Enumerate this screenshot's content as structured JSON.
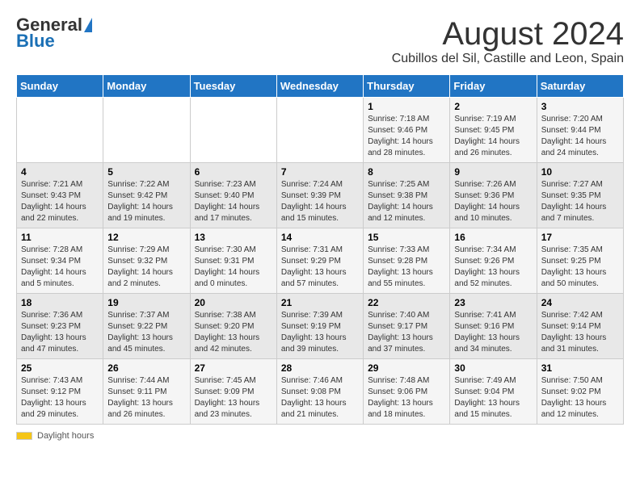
{
  "header": {
    "logo_line1": "General",
    "logo_line2": "Blue",
    "main_title": "August 2024",
    "subtitle": "Cubillos del Sil, Castille and Leon, Spain"
  },
  "calendar": {
    "days_of_week": [
      "Sunday",
      "Monday",
      "Tuesday",
      "Wednesday",
      "Thursday",
      "Friday",
      "Saturday"
    ],
    "weeks": [
      [
        {
          "day": "",
          "sunrise": "",
          "sunset": "",
          "daylight": ""
        },
        {
          "day": "",
          "sunrise": "",
          "sunset": "",
          "daylight": ""
        },
        {
          "day": "",
          "sunrise": "",
          "sunset": "",
          "daylight": ""
        },
        {
          "day": "",
          "sunrise": "",
          "sunset": "",
          "daylight": ""
        },
        {
          "day": "1",
          "sunrise": "7:18 AM",
          "sunset": "9:46 PM",
          "daylight": "14 hours and 28 minutes."
        },
        {
          "day": "2",
          "sunrise": "7:19 AM",
          "sunset": "9:45 PM",
          "daylight": "14 hours and 26 minutes."
        },
        {
          "day": "3",
          "sunrise": "7:20 AM",
          "sunset": "9:44 PM",
          "daylight": "14 hours and 24 minutes."
        }
      ],
      [
        {
          "day": "4",
          "sunrise": "7:21 AM",
          "sunset": "9:43 PM",
          "daylight": "14 hours and 22 minutes."
        },
        {
          "day": "5",
          "sunrise": "7:22 AM",
          "sunset": "9:42 PM",
          "daylight": "14 hours and 19 minutes."
        },
        {
          "day": "6",
          "sunrise": "7:23 AM",
          "sunset": "9:40 PM",
          "daylight": "14 hours and 17 minutes."
        },
        {
          "day": "7",
          "sunrise": "7:24 AM",
          "sunset": "9:39 PM",
          "daylight": "14 hours and 15 minutes."
        },
        {
          "day": "8",
          "sunrise": "7:25 AM",
          "sunset": "9:38 PM",
          "daylight": "14 hours and 12 minutes."
        },
        {
          "day": "9",
          "sunrise": "7:26 AM",
          "sunset": "9:36 PM",
          "daylight": "14 hours and 10 minutes."
        },
        {
          "day": "10",
          "sunrise": "7:27 AM",
          "sunset": "9:35 PM",
          "daylight": "14 hours and 7 minutes."
        }
      ],
      [
        {
          "day": "11",
          "sunrise": "7:28 AM",
          "sunset": "9:34 PM",
          "daylight": "14 hours and 5 minutes."
        },
        {
          "day": "12",
          "sunrise": "7:29 AM",
          "sunset": "9:32 PM",
          "daylight": "14 hours and 2 minutes."
        },
        {
          "day": "13",
          "sunrise": "7:30 AM",
          "sunset": "9:31 PM",
          "daylight": "14 hours and 0 minutes."
        },
        {
          "day": "14",
          "sunrise": "7:31 AM",
          "sunset": "9:29 PM",
          "daylight": "13 hours and 57 minutes."
        },
        {
          "day": "15",
          "sunrise": "7:33 AM",
          "sunset": "9:28 PM",
          "daylight": "13 hours and 55 minutes."
        },
        {
          "day": "16",
          "sunrise": "7:34 AM",
          "sunset": "9:26 PM",
          "daylight": "13 hours and 52 minutes."
        },
        {
          "day": "17",
          "sunrise": "7:35 AM",
          "sunset": "9:25 PM",
          "daylight": "13 hours and 50 minutes."
        }
      ],
      [
        {
          "day": "18",
          "sunrise": "7:36 AM",
          "sunset": "9:23 PM",
          "daylight": "13 hours and 47 minutes."
        },
        {
          "day": "19",
          "sunrise": "7:37 AM",
          "sunset": "9:22 PM",
          "daylight": "13 hours and 45 minutes."
        },
        {
          "day": "20",
          "sunrise": "7:38 AM",
          "sunset": "9:20 PM",
          "daylight": "13 hours and 42 minutes."
        },
        {
          "day": "21",
          "sunrise": "7:39 AM",
          "sunset": "9:19 PM",
          "daylight": "13 hours and 39 minutes."
        },
        {
          "day": "22",
          "sunrise": "7:40 AM",
          "sunset": "9:17 PM",
          "daylight": "13 hours and 37 minutes."
        },
        {
          "day": "23",
          "sunrise": "7:41 AM",
          "sunset": "9:16 PM",
          "daylight": "13 hours and 34 minutes."
        },
        {
          "day": "24",
          "sunrise": "7:42 AM",
          "sunset": "9:14 PM",
          "daylight": "13 hours and 31 minutes."
        }
      ],
      [
        {
          "day": "25",
          "sunrise": "7:43 AM",
          "sunset": "9:12 PM",
          "daylight": "13 hours and 29 minutes."
        },
        {
          "day": "26",
          "sunrise": "7:44 AM",
          "sunset": "9:11 PM",
          "daylight": "13 hours and 26 minutes."
        },
        {
          "day": "27",
          "sunrise": "7:45 AM",
          "sunset": "9:09 PM",
          "daylight": "13 hours and 23 minutes."
        },
        {
          "day": "28",
          "sunrise": "7:46 AM",
          "sunset": "9:08 PM",
          "daylight": "13 hours and 21 minutes."
        },
        {
          "day": "29",
          "sunrise": "7:48 AM",
          "sunset": "9:06 PM",
          "daylight": "13 hours and 18 minutes."
        },
        {
          "day": "30",
          "sunrise": "7:49 AM",
          "sunset": "9:04 PM",
          "daylight": "13 hours and 15 minutes."
        },
        {
          "day": "31",
          "sunrise": "7:50 AM",
          "sunset": "9:02 PM",
          "daylight": "13 hours and 12 minutes."
        }
      ]
    ]
  },
  "footer": {
    "daylight_label": "Daylight hours"
  }
}
